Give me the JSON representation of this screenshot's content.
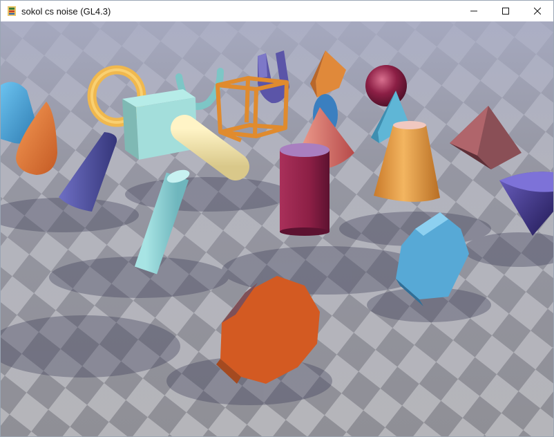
{
  "window": {
    "title": "sokol cs noise (GL4.3)",
    "controls": [
      {
        "name": "minimize-button",
        "icon": "minimize-icon"
      },
      {
        "name": "maximize-button",
        "icon": "maximize-icon"
      },
      {
        "name": "close-button",
        "icon": "close-icon"
      }
    ]
  },
  "scene": {
    "description_icons": [
      "torus-shape",
      "sphere-shape",
      "cube-shape",
      "capsule-shape",
      "cone-shape",
      "cylinder-shape",
      "octahedron-shape",
      "hexagonal-prism-shape",
      "octagonal-prism-shape",
      "wireframe-cube-shape"
    ],
    "colors": {
      "sky_top": "#9aa3c4",
      "floor_light": "#b8b8bd",
      "floor_dark": "#8e8e94",
      "accent_orange": "#e0893a",
      "accent_blue": "#4aa6d8",
      "accent_purple": "#4c4d9e",
      "accent_crimson": "#8c1f45",
      "accent_cream": "#f5e6a8",
      "accent_teal": "#8fd6d6"
    }
  }
}
